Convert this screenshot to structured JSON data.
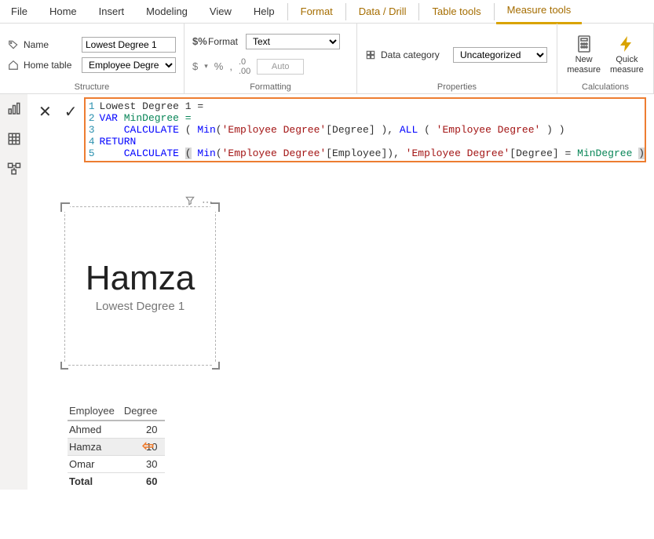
{
  "menu": {
    "file": "File",
    "home": "Home",
    "insert": "Insert",
    "modeling": "Modeling",
    "view": "View",
    "help": "Help",
    "format": "Format",
    "datadrill": "Data / Drill",
    "tabletools": "Table tools",
    "measuretools": "Measure tools"
  },
  "ribbon": {
    "structure": {
      "label": "Structure",
      "name_label": "Name",
      "name_value": "Lowest Degree 1",
      "home_table_label": "Home table",
      "home_table_value": "Employee Degree"
    },
    "formatting": {
      "label": "Formatting",
      "format_label": "Format",
      "format_value": "Text",
      "dollar": "$",
      "percent": "%",
      "comma": ",",
      "dec_inc": ".0",
      "dec_dec": ".00",
      "auto": "Auto"
    },
    "properties": {
      "label": "Properties",
      "datacat_label": "Data category",
      "datacat_value": "Uncategorized"
    },
    "calculations": {
      "label": "Calculations",
      "new_measure": "New measure",
      "quick_measure": "Quick measure"
    }
  },
  "formula": {
    "ln1": "Lowest Degree 1 =",
    "ln2_var": "VAR",
    "ln2_name": "MinDegree =",
    "ln3_calc": "CALCULATE",
    "ln3_min": "Min",
    "ln3_tbl": "'Employee Degree'",
    "ln3_col": "[Degree]",
    "ln3_all": "ALL",
    "ln4": "RETURN",
    "ln5_calc": "CALCULATE",
    "ln5_min": "Min",
    "ln5_tbl": "'Employee Degree'",
    "ln5_col1": "[Employee]",
    "ln5_col2": "[Degree]",
    "ln5_eq": "=",
    "ln5_var": "MinDegree"
  },
  "card": {
    "value": "Hamza",
    "label": "Lowest Degree 1"
  },
  "table": {
    "headers": {
      "emp": "Employee",
      "deg": "Degree"
    },
    "rows": [
      {
        "emp": "Ahmed",
        "deg": "20"
      },
      {
        "emp": "Hamza",
        "deg": "10"
      },
      {
        "emp": "Omar",
        "deg": "30"
      }
    ],
    "total_label": "Total",
    "total_value": "60"
  }
}
